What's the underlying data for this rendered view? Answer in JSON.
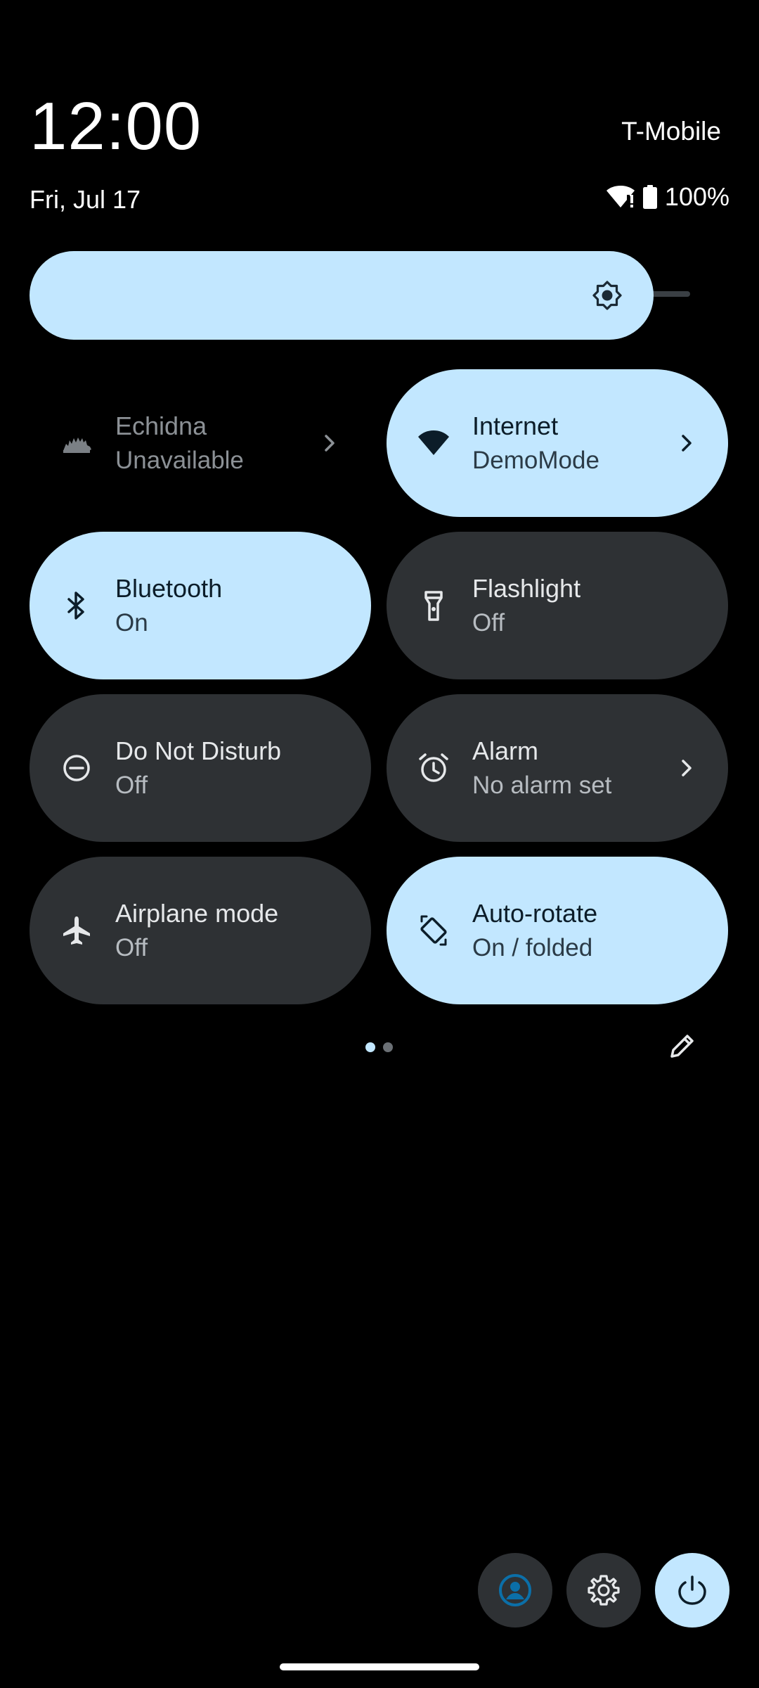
{
  "header": {
    "time": "12:00",
    "carrier": "T-Mobile",
    "date": "Fri, Jul 17",
    "battery_text": "100%"
  },
  "brightness": {
    "level": 0.9
  },
  "tiles": [
    {
      "title": "Echidna",
      "subtitle": "Unavailable",
      "state": "unavailable",
      "icon": "echidna-icon",
      "has_chevron": true
    },
    {
      "title": "Internet",
      "subtitle": "DemoMode",
      "state": "active",
      "icon": "wifi-icon",
      "has_chevron": true
    },
    {
      "title": "Bluetooth",
      "subtitle": "On",
      "state": "active",
      "icon": "bluetooth-icon",
      "has_chevron": false
    },
    {
      "title": "Flashlight",
      "subtitle": "Off",
      "state": "inactive",
      "icon": "flashlight-icon",
      "has_chevron": false
    },
    {
      "title": "Do Not Disturb",
      "subtitle": "Off",
      "state": "inactive",
      "icon": "do-not-disturb-icon",
      "has_chevron": false
    },
    {
      "title": "Alarm",
      "subtitle": "No alarm set",
      "state": "inactive",
      "icon": "alarm-icon",
      "has_chevron": true
    },
    {
      "title": "Airplane mode",
      "subtitle": "Off",
      "state": "inactive",
      "icon": "airplane-icon",
      "has_chevron": false
    },
    {
      "title": "Auto-rotate",
      "subtitle": "On / folded",
      "state": "active",
      "icon": "auto-rotate-icon",
      "has_chevron": false
    }
  ],
  "pager": {
    "pages": 2,
    "current": 1
  },
  "footer": {
    "buttons": [
      "user-switcher-icon",
      "settings-icon",
      "power-icon"
    ]
  },
  "colors": {
    "background": "#000000",
    "tile_active": "#c2e7ff",
    "tile_inactive": "#2e3134",
    "accent_blue": "#0b57d0"
  }
}
